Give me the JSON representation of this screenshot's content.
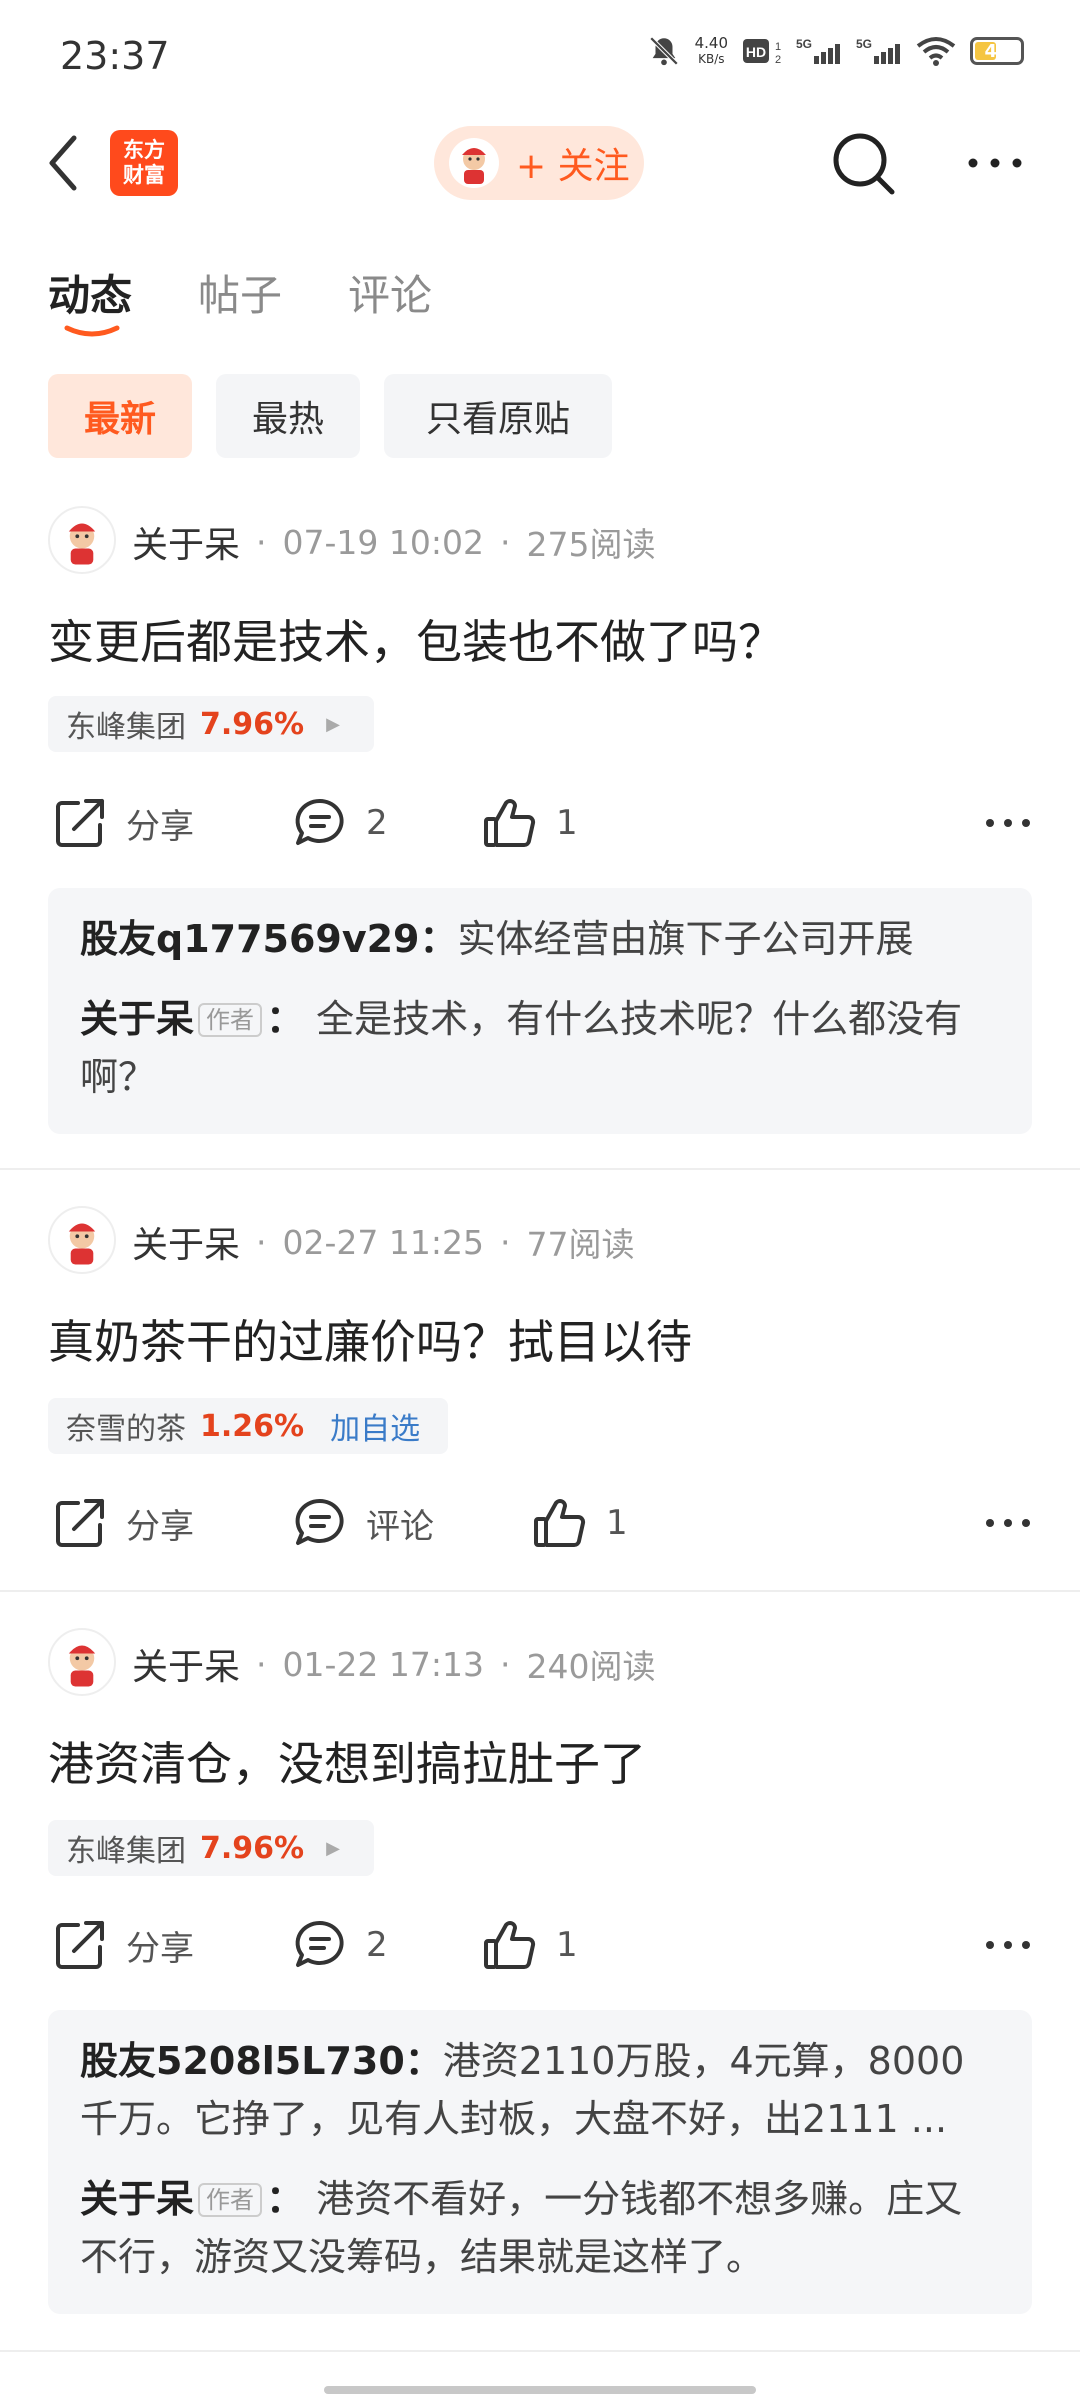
{
  "status_bar": {
    "time": "23:37",
    "net_speed_value": "4.40",
    "net_speed_unit": "KB/s",
    "battery": "41"
  },
  "header": {
    "logo_line1": "东方",
    "logo_line2": "财富",
    "follow_label": "+ 关注"
  },
  "tabs": [
    {
      "label": "动态"
    },
    {
      "label": "帖子"
    },
    {
      "label": "评论"
    }
  ],
  "filters": [
    {
      "label": "最新"
    },
    {
      "label": "最热"
    },
    {
      "label": "只看原贴"
    }
  ],
  "posts": [
    {
      "author": "关于呆",
      "time": "07-19 10:02",
      "reads": "275阅读",
      "title": "变更后都是技术，包装也不做了吗？",
      "stock": {
        "name": "东峰集团",
        "change": "7.96%"
      },
      "share": "分享",
      "comments": "2",
      "likes": "1",
      "replies": [
        {
          "user": "股友q177569v29",
          "sep": "：",
          "text": "实体经营由旗下子公司开展"
        },
        {
          "user": "关于呆",
          "tag": "作者",
          "sep": "：",
          "text": " 全是技术，有什么技术呢？什么都没有啊？"
        }
      ]
    },
    {
      "author": "关于呆",
      "time": "02-27 11:25",
      "reads": "77阅读",
      "title": "真奶茶干的过廉价吗？拭目以待",
      "stock": {
        "name": "奈雪的茶",
        "change": "1.26%",
        "add_label": "加自选"
      },
      "share": "分享",
      "comments": "评论",
      "likes": "1"
    },
    {
      "author": "关于呆",
      "time": "01-22 17:13",
      "reads": "240阅读",
      "title": "港资清仓，没想到搞拉肚子了",
      "stock": {
        "name": "东峰集团",
        "change": "7.96%"
      },
      "share": "分享",
      "comments": "2",
      "likes": "1",
      "replies": [
        {
          "user": "股友5208l5L730",
          "sep": "：",
          "text": "港资2110万股，4元算，8000千万。它挣了，见有人封板，大盘不好，出2111 ..."
        },
        {
          "user": "关于呆",
          "tag": "作者",
          "sep": "：",
          "text": " 港资不看好，一分钱都不想多赚。庄又不行，游资又没筹码，结果就是这样了。"
        }
      ]
    }
  ],
  "colors": {
    "accent": "#ff5a1f",
    "rise": "#e4431d",
    "link": "#3a7bc8"
  }
}
